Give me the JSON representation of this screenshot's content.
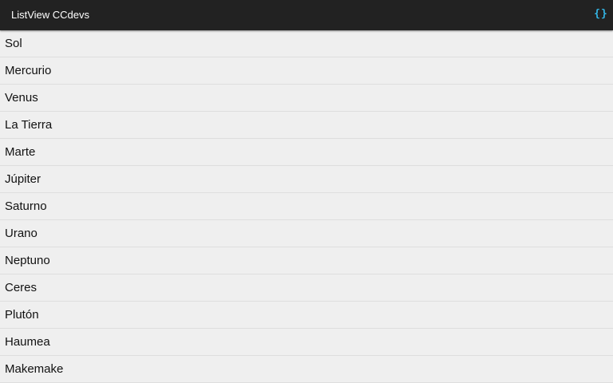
{
  "action_bar": {
    "title": "ListView CCdevs",
    "icon": "{}",
    "icon_color": "#33b5e5",
    "background": "#222222"
  },
  "list": {
    "items": [
      {
        "label": "Sol"
      },
      {
        "label": "Mercurio"
      },
      {
        "label": "Venus"
      },
      {
        "label": "La Tierra"
      },
      {
        "label": "Marte"
      },
      {
        "label": "Júpiter"
      },
      {
        "label": "Saturno"
      },
      {
        "label": "Urano"
      },
      {
        "label": "Neptuno"
      },
      {
        "label": "Ceres"
      },
      {
        "label": "Plutón"
      },
      {
        "label": "Haumea"
      },
      {
        "label": "Makemake"
      }
    ]
  }
}
